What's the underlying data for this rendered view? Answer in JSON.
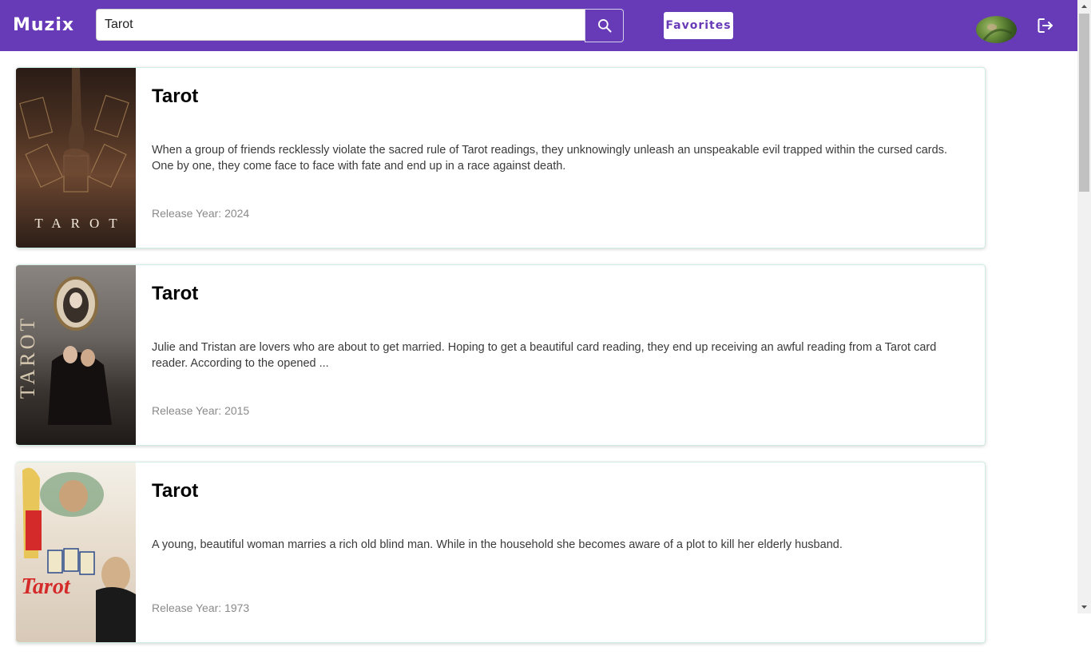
{
  "app": {
    "logo": "Muzix",
    "search": {
      "value": "Tarot",
      "placeholder": ""
    },
    "favorites_label": "Favorites",
    "colors": {
      "brand": "#673ab7",
      "accent_border": "#cfeee6"
    }
  },
  "results": [
    {
      "title": "Tarot",
      "description": "When a group of friends recklessly violate the sacred rule of Tarot readings, they unknowingly unleash an unspeakable evil trapped within the cursed cards. One by one, they come face to face with fate and end up in a race against death.",
      "year_label": "Release Year: 2024",
      "poster_text": "TAROT"
    },
    {
      "title": "Tarot",
      "description": "Julie and Tristan are lovers who are about to get married. Hoping to get a beautiful card reading, they end up receiving an awful reading from a Tarot card reader. According to the opened ...",
      "year_label": "Release Year: 2015",
      "poster_text": "TAROT"
    },
    {
      "title": "Tarot",
      "description": "A young, beautiful woman marries a rich old blind man. While in the household she becomes aware of a plot to kill her elderly husband.",
      "year_label": "Release Year: 1973",
      "poster_text": "Tarot"
    }
  ]
}
